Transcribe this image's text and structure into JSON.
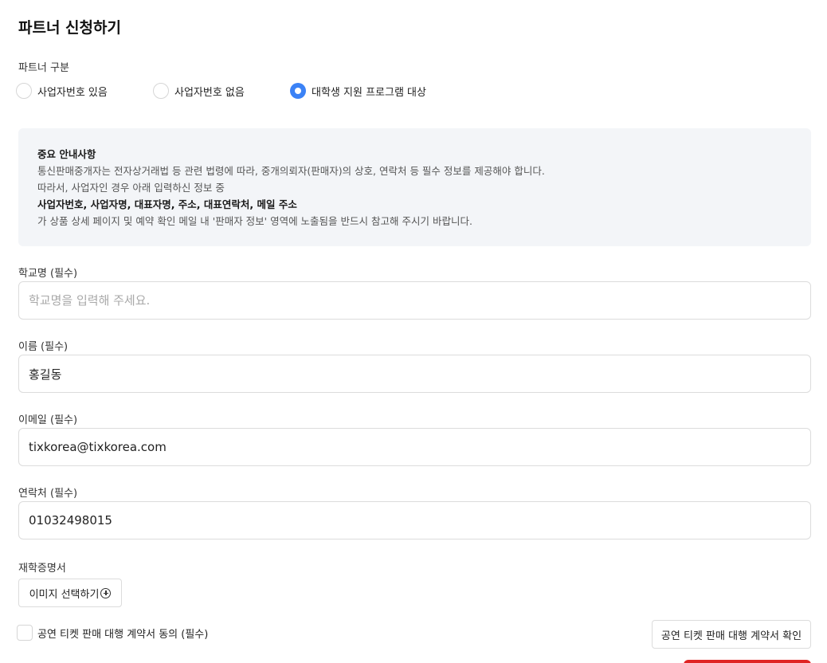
{
  "page": {
    "title": "파트너 신청하기"
  },
  "partner_type": {
    "label": "파트너 구분",
    "options": [
      {
        "label": "사업자번호 있음",
        "selected": false
      },
      {
        "label": "사업자번호 없음",
        "selected": false
      },
      {
        "label": "대학생 지원 프로그램 대상",
        "selected": true
      }
    ]
  },
  "notice": {
    "title": "중요 안내사항",
    "line1": "통신판매중개자는 전자상거래법 등 관련 법령에 따라, 중개의뢰자(판매자)의 상호, 연락처 등 필수 정보를 제공해야 합니다.",
    "line2": "따라서, 사업자인 경우 아래 입력하신 정보 중",
    "line3": "사업자번호, 사업자명, 대표자명, 주소, 대표연락처, 메일 주소",
    "line4": "가 상품 상세 페이지 및 예약 확인 메일 내 '판매자 정보' 영역에 노출됨을 반드시 참고해 주시기 바랍니다."
  },
  "form": {
    "school": {
      "label": "학교명 (필수)",
      "value": "",
      "placeholder": "학교명을 입력해 주세요."
    },
    "name": {
      "label": "이름 (필수)",
      "value": "홍길동"
    },
    "email": {
      "label": "이메일 (필수)",
      "value": "tixkorea@tixkorea.com"
    },
    "phone": {
      "label": "연락처 (필수)",
      "value": "01032498015"
    },
    "certificate": {
      "label": "재학증명서",
      "button_label": "이미지 선택하기"
    }
  },
  "agreement": {
    "checkbox_label": "공연 티켓 판매 대행 계약서 동의 (필수)",
    "checked": false,
    "contract_button_label": "공연 티켓 판매 대행 계약서 확인"
  },
  "colors": {
    "accent": "#3b82f6",
    "notice_bg": "#f3f5f8",
    "submit": "#e02424"
  },
  "icons": {
    "image_button": "plus-circle-icon"
  }
}
